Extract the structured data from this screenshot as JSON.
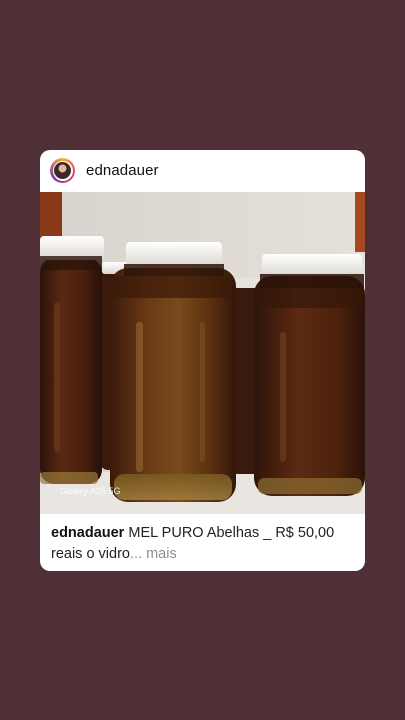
{
  "post": {
    "username": "ednadauer",
    "avatar_icon": "profile-avatar",
    "photo_watermark": "Galaxy A25 5G",
    "caption": {
      "username": "ednadauer",
      "text_line1": " MEL PURO Abelhas _ R$ 50,00",
      "text_line2": "reais o vidro",
      "more": "... mais"
    }
  },
  "colors": {
    "background": "#4e3036",
    "card": "#ffffff",
    "honey": "#5a2a12",
    "lid": "#f4f1ea"
  }
}
